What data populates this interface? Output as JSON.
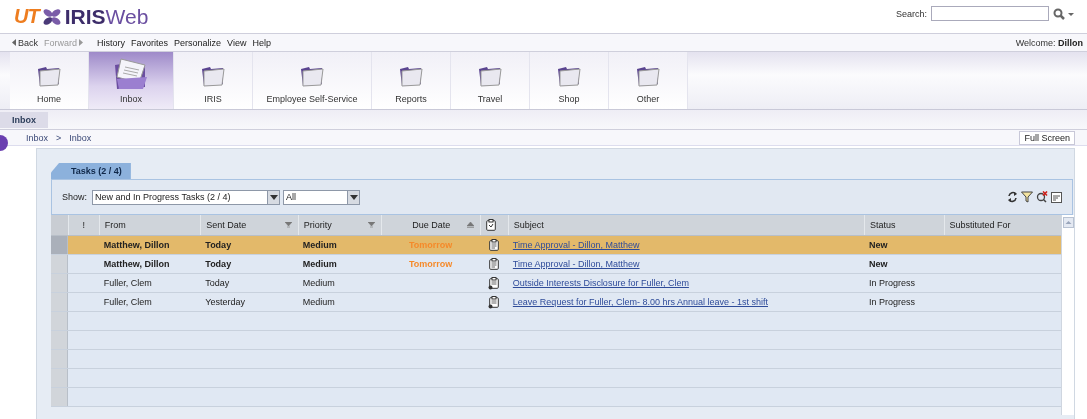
{
  "logo": {
    "mark": "UT",
    "name_bold": "IRIS",
    "name_light": "Web"
  },
  "search": {
    "label": "Search:"
  },
  "menu": {
    "nav": [
      {
        "label": "Back",
        "disabled": false
      },
      {
        "label": "Forward",
        "disabled": true
      }
    ],
    "items": [
      "History",
      "Favorites",
      "Personalize",
      "View",
      "Help"
    ],
    "welcome_label": "Welcome:",
    "user": "Dillon"
  },
  "nav_tabs": [
    {
      "label": "Home",
      "selected": false
    },
    {
      "label": "Inbox",
      "selected": true
    },
    {
      "label": "IRIS",
      "selected": false
    },
    {
      "label": "Employee Self-Service",
      "selected": false
    },
    {
      "label": "Reports",
      "selected": false
    },
    {
      "label": "Travel",
      "selected": false
    },
    {
      "label": "Shop",
      "selected": false
    },
    {
      "label": "Other",
      "selected": false
    }
  ],
  "sub_tab": "Inbox",
  "breadcrumb": [
    "Inbox",
    "Inbox"
  ],
  "breadcrumb_sep": ">",
  "full_screen": "Full Screen",
  "tasks_tab": "Tasks  (2 / 4)",
  "show": {
    "label": "Show:",
    "filter": "New and In Progress Tasks  (2 / 4)",
    "scope": "All"
  },
  "table": {
    "columns": [
      {
        "label": "!"
      },
      {
        "label": "From"
      },
      {
        "label": "Sent Date"
      },
      {
        "label": "Priority"
      },
      {
        "label": "Due Date"
      },
      {},
      {
        "label": "Subject"
      },
      {
        "label": "Status"
      },
      {
        "label": "Substituted For"
      }
    ],
    "rows": [
      {
        "from": "Matthew, Dillon",
        "sent": "Today",
        "priority": "Medium",
        "due": "Tomorrow",
        "kind": "task",
        "subject": "Time Approval - Dillon, Matthew",
        "status": "New",
        "unread": true,
        "selected": true
      },
      {
        "from": "Matthew, Dillon",
        "sent": "Today",
        "priority": "Medium",
        "due": "Tomorrow",
        "kind": "task",
        "subject": "Time Approval - Dillon, Matthew",
        "status": "New",
        "unread": true,
        "selected": false
      },
      {
        "from": "Fuller, Clem",
        "sent": "Today",
        "priority": "Medium",
        "kind": "request",
        "subject": "Outside Interests Disclosure for Fuller, Clem",
        "status": "In Progress",
        "unread": false,
        "selected": false
      },
      {
        "from": "Fuller, Clem",
        "sent": "Yesterday",
        "priority": "Medium",
        "kind": "request",
        "subject": "Leave Request for Fuller, Clem- 8.00 hrs Annual leave - 1st shift",
        "status": "In Progress",
        "unread": false,
        "selected": false
      }
    ]
  }
}
